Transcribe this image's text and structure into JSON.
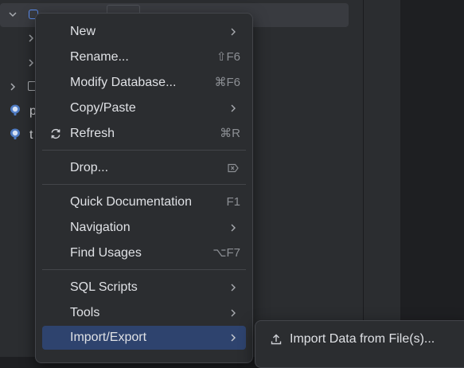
{
  "tree": {
    "partial_labels": [
      "p",
      "t"
    ]
  },
  "context_menu": {
    "items": [
      {
        "label": "New",
        "shortcut": "",
        "has_submenu": true
      },
      {
        "label": "Rename...",
        "shortcut": "⇧F6",
        "has_submenu": false
      },
      {
        "label": "Modify Database...",
        "shortcut": "⌘F6",
        "has_submenu": false
      },
      {
        "label": "Copy/Paste",
        "shortcut": "",
        "has_submenu": true
      },
      {
        "label": "Refresh",
        "shortcut": "⌘R",
        "has_submenu": false,
        "icon": "refresh-icon"
      },
      {
        "label": "Drop...",
        "shortcut": "⌦",
        "has_submenu": false
      },
      {
        "label": "Quick Documentation",
        "shortcut": "F1",
        "has_submenu": false
      },
      {
        "label": "Navigation",
        "shortcut": "",
        "has_submenu": true
      },
      {
        "label": "Find Usages",
        "shortcut": "⌥F7",
        "has_submenu": false
      },
      {
        "label": "SQL Scripts",
        "shortcut": "",
        "has_submenu": true
      },
      {
        "label": "Tools",
        "shortcut": "",
        "has_submenu": true
      },
      {
        "label": "Import/Export",
        "shortcut": "",
        "has_submenu": true,
        "highlighted": true
      }
    ]
  },
  "submenu": {
    "items": [
      {
        "label": "Import Data from File(s)...",
        "icon": "upload-icon"
      }
    ]
  },
  "colors": {
    "highlight": "#2e436e",
    "menu_bg": "#2b2d30",
    "text": "#dfe1e5",
    "shortcut_text": "#8c8f94"
  }
}
